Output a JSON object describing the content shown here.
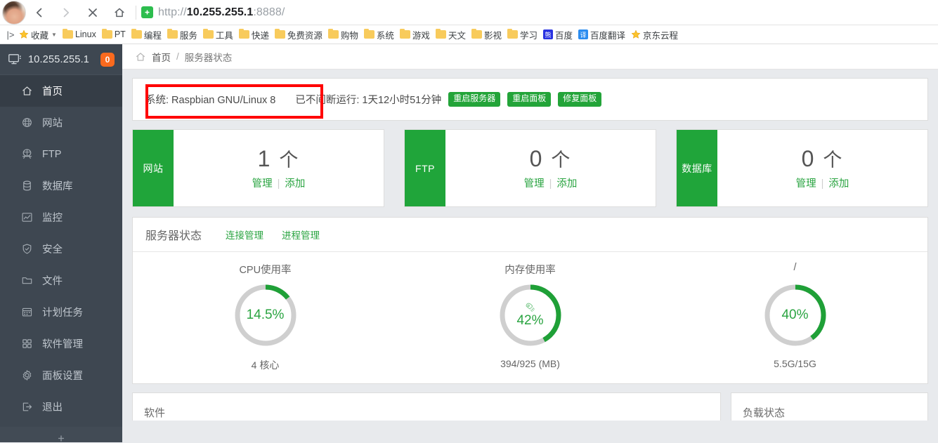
{
  "browser": {
    "avatar_name": "user-avatar",
    "back_label": "后退",
    "forward_label": "前进",
    "stop_label": "停止",
    "home_label": "主页",
    "url": {
      "scheme": "http://",
      "host": "10.255.255.1",
      "port": ":8888/"
    },
    "bookmarks_overflow": "|>",
    "bookmarks": [
      {
        "label": "收藏",
        "icon": "star-icon",
        "has_chevron": true
      },
      {
        "label": "Linux",
        "icon": "folder-icon"
      },
      {
        "label": "PT",
        "icon": "folder-icon"
      },
      {
        "label": "编程",
        "icon": "folder-icon"
      },
      {
        "label": "服务",
        "icon": "folder-icon"
      },
      {
        "label": "工具",
        "icon": "folder-icon"
      },
      {
        "label": "快递",
        "icon": "folder-icon"
      },
      {
        "label": "免费资源",
        "icon": "folder-icon"
      },
      {
        "label": "购物",
        "icon": "folder-icon"
      },
      {
        "label": "系统",
        "icon": "folder-icon"
      },
      {
        "label": "游戏",
        "icon": "folder-icon"
      },
      {
        "label": "天文",
        "icon": "folder-icon"
      },
      {
        "label": "影视",
        "icon": "folder-icon"
      },
      {
        "label": "学习",
        "icon": "folder-icon"
      },
      {
        "label": "百度",
        "icon": "baidu-icon",
        "glyph": "熊",
        "bg": "#2932e1"
      },
      {
        "label": "百度翻译",
        "icon": "fanyi-icon",
        "glyph": "译",
        "bg": "#2b8cf0"
      },
      {
        "label": "京东云程",
        "icon": "star-icon"
      }
    ]
  },
  "sidebar": {
    "host": "10.255.255.1",
    "badge": "0",
    "monitor_icon": "monitor-icon",
    "items": [
      {
        "label": "首页",
        "icon": "home-icon",
        "active": true
      },
      {
        "label": "网站",
        "icon": "globe-icon",
        "active": false
      },
      {
        "label": "FTP",
        "icon": "ftp-icon",
        "active": false
      },
      {
        "label": "数据库",
        "icon": "database-icon",
        "active": false
      },
      {
        "label": "监控",
        "icon": "chart-icon",
        "active": false
      },
      {
        "label": "安全",
        "icon": "shield-icon",
        "active": false
      },
      {
        "label": "文件",
        "icon": "folder-icon",
        "active": false
      },
      {
        "label": "计划任务",
        "icon": "calendar-icon",
        "active": false
      },
      {
        "label": "软件管理",
        "icon": "grid-icon",
        "active": false
      },
      {
        "label": "面板设置",
        "icon": "gear-icon",
        "active": false
      },
      {
        "label": "退出",
        "icon": "logout-icon",
        "active": false
      }
    ]
  },
  "breadcrumb": {
    "home_icon": "home-icon",
    "home": "首页",
    "separator": "/",
    "current": "服务器状态"
  },
  "system_bar": {
    "system": "系统: Raspbian GNU/Linux 8",
    "uptime": "已不间断运行: 1天12小时51分钟",
    "buttons": [
      "重启服务器",
      "重启面板",
      "修复面板"
    ],
    "highlight_color": "#ff0000"
  },
  "stat_cards": [
    {
      "side_label": "网站",
      "count": "1",
      "unit": "个",
      "manage": "管理",
      "add": "添加"
    },
    {
      "side_label": "FTP",
      "count": "0",
      "unit": "个",
      "manage": "管理",
      "add": "添加"
    },
    {
      "side_label": "数据库",
      "count": "0",
      "unit": "个",
      "manage": "管理",
      "add": "添加"
    }
  ],
  "status_panel": {
    "title": "服务器状态",
    "tabs": [
      {
        "label": "连接管理"
      },
      {
        "label": "进程管理"
      }
    ]
  },
  "chart_data": {
    "type": "pie",
    "title": "服务器状态",
    "gauges": [
      {
        "label": "CPU使用率",
        "value": 14.5,
        "display": "14.5%",
        "sub": "4 核心",
        "icon": "",
        "max": 100,
        "color": "#1fa037",
        "track": "#cfcfcf"
      },
      {
        "label": "内存使用率",
        "value": 42,
        "display": "42%",
        "sub": "394/925 (MB)",
        "icon": "rocket-icon",
        "max": 100,
        "color": "#1fa037",
        "track": "#cfcfcf"
      },
      {
        "label": "/",
        "value": 40,
        "display": "40%",
        "sub": "5.5G/15G",
        "icon": "",
        "max": 100,
        "color": "#1fa037",
        "track": "#cfcfcf"
      }
    ]
  },
  "bottom_cards": [
    {
      "title": "软件"
    },
    {
      "title": "负载状态"
    }
  ]
}
